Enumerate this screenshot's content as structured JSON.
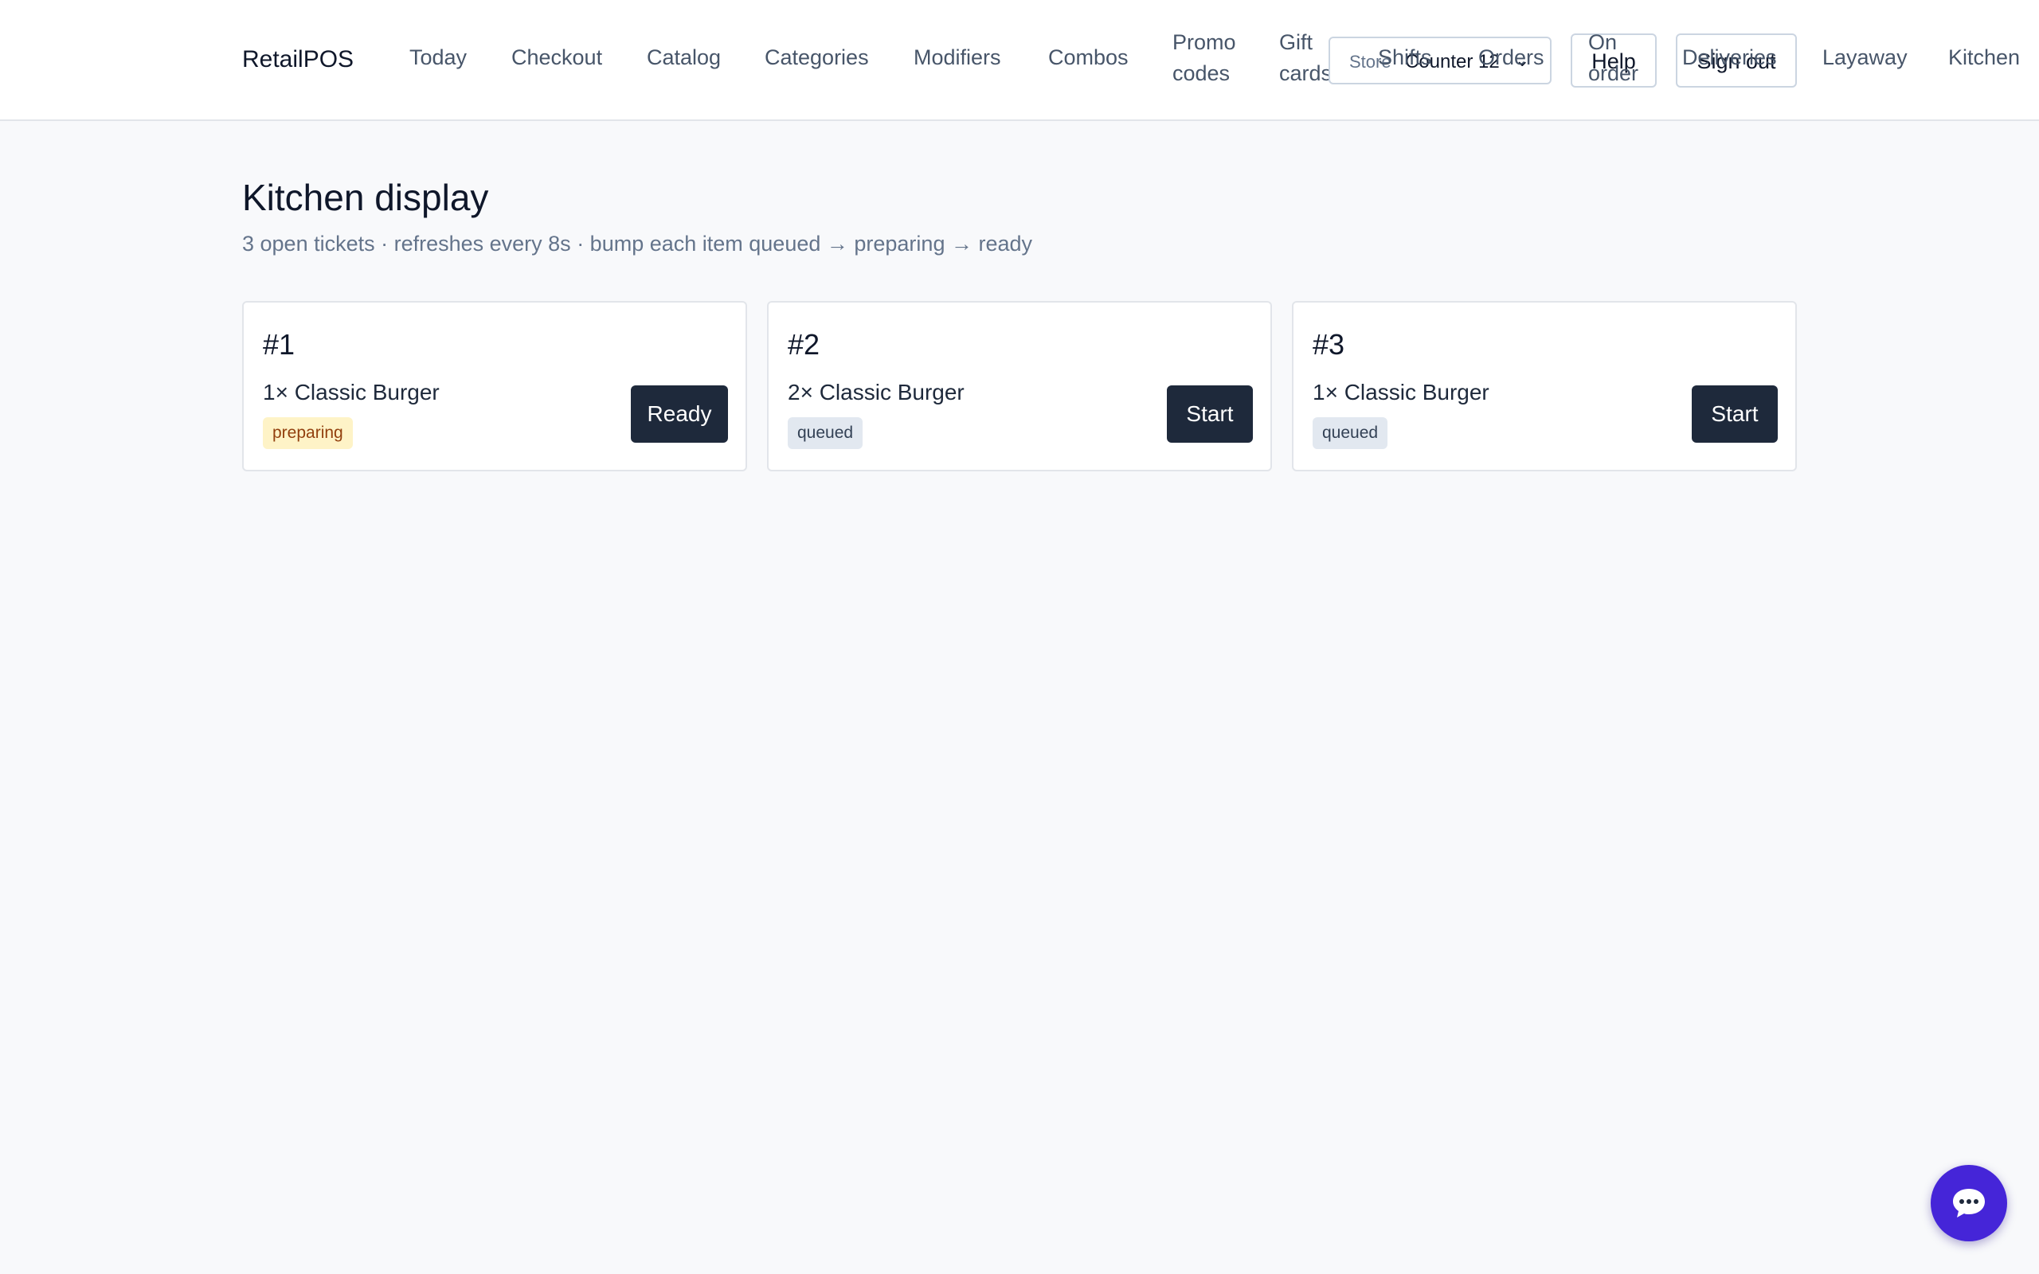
{
  "app": {
    "brand": "RetailPOS"
  },
  "nav": {
    "items": [
      {
        "label": "Today"
      },
      {
        "label": "Checkout"
      },
      {
        "label": "Catalog"
      },
      {
        "label": "Categories"
      },
      {
        "label": "Modifiers"
      },
      {
        "label": "Combos"
      },
      {
        "label": "Promo\ncodes"
      },
      {
        "label": "Gift\ncards"
      },
      {
        "label": "Shifts"
      },
      {
        "label": "Orders"
      },
      {
        "label": "On\norder"
      },
      {
        "label": "Deliveries"
      },
      {
        "label": "Layaway"
      },
      {
        "label": "Kitchen"
      }
    ]
  },
  "header": {
    "store_label": "Store",
    "store_value": "Counter 12",
    "store_chevron": "⌄",
    "help_label": "Help",
    "signout_label": "Sign out"
  },
  "page": {
    "title": "Kitchen display",
    "subtitle": "3 open tickets · refreshes every 8s · bump each item queued → preparing → ready"
  },
  "tickets": [
    {
      "number": "#1",
      "item": "1× Classic Burger",
      "status": "preparing",
      "action": "Ready"
    },
    {
      "number": "#2",
      "item": "2× Classic Burger",
      "status": "queued",
      "action": "Start"
    },
    {
      "number": "#3",
      "item": "1× Classic Burger",
      "status": "queued",
      "action": "Start"
    }
  ],
  "colors": {
    "accent": "#4525d8",
    "button_dark": "#1e293b",
    "badge_preparing_bg": "#fef3c7",
    "badge_queued_bg": "#e2e8f0"
  },
  "icons": {
    "chat": "chat-bubble-icon"
  }
}
